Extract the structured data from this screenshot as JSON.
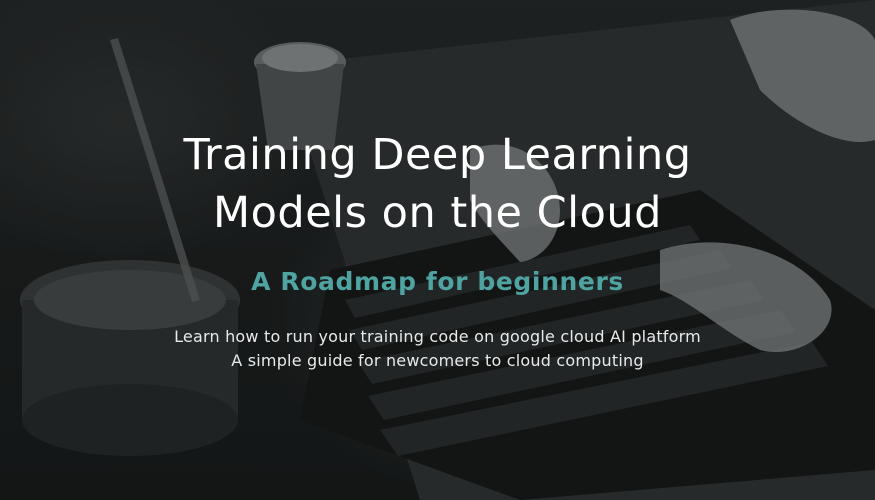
{
  "hero": {
    "title_line_1": "Training Deep Learning",
    "title_line_2": "Models on the Cloud",
    "subtitle": "A Roadmap for beginners",
    "description_line_1": "Learn how to run your training code on google cloud AI platform",
    "description_line_2": "A simple guide for newcomers to cloud computing"
  },
  "colors": {
    "title": "#ffffff",
    "subtitle_accent": "#4fa3a1",
    "description": "#e8eaea",
    "background": "#1c1e1e"
  }
}
